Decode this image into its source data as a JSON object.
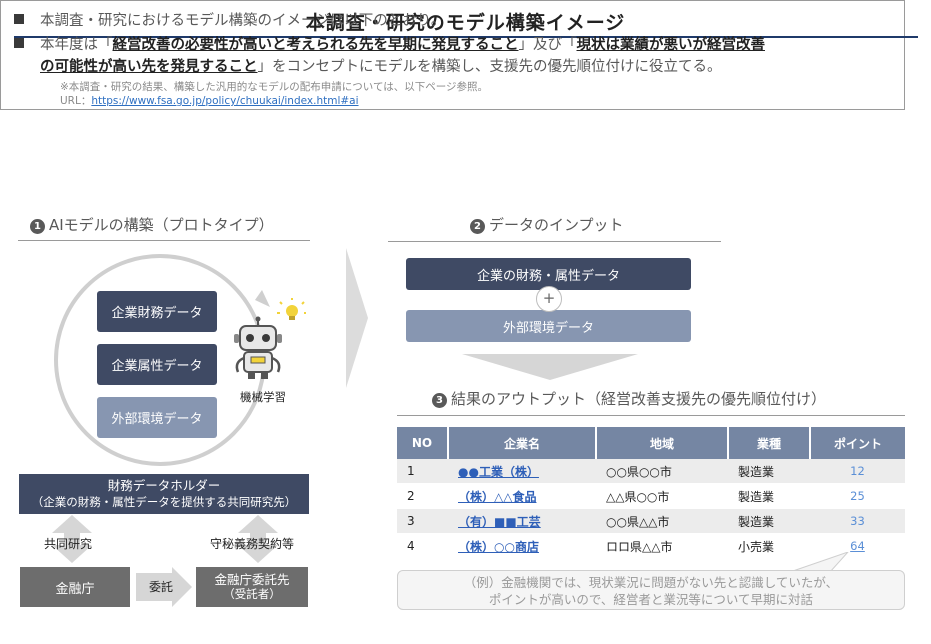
{
  "title": "本調査・研究のモデル構築イメージ",
  "summary": {
    "line1": "本調査・研究におけるモデル構築のイメージは以下のとおり。",
    "line2_pre": "本年度は「",
    "line2_hl1": "経営改善の必要性が高いと考えられる先を早期に発見すること",
    "line2_mid": "」及び「",
    "line2_hl2a": "現状は業績が悪いが経営改善",
    "line3_hl2b": "の可能性が高い先を発見すること",
    "line3_post": "」をコンセプトにモデルを構築し、支援先の優先順位付けに役立てる。",
    "note": "※本調査・研究の結果、構築した汎用的なモデルの配布申請については、以下ページ参照。",
    "url_label": "URL：",
    "url": "https://www.fsa.go.jp/policy/chuukai/index.html#ai"
  },
  "section1": {
    "number": "1",
    "title": "AIモデルの構築（プロトタイプ）",
    "boxes": [
      "企業財務データ",
      "企業属性データ",
      "外部環境データ"
    ],
    "robot_label": "機械学習",
    "holder_line1": "財務データホルダー",
    "holder_line2": "（企業の財務・属性データを提供する共同研究先）",
    "joint_research": "共同研究",
    "confidentiality": "守秘義務契約等",
    "fsa": "金融庁",
    "entrust": "委託",
    "contractor_line1": "金融庁委託先",
    "contractor_line2": "（受託者）"
  },
  "section2": {
    "number": "2",
    "title": "データのインプット",
    "box1": "企業の財務・属性データ",
    "plus": "+",
    "box2": "外部環境データ"
  },
  "section3": {
    "number": "3",
    "title": "結果のアウトプット（経営改善支援先の優先順位付け）",
    "headers": [
      "NO",
      "企業名",
      "地域",
      "業種",
      "ポイント"
    ],
    "rows": [
      {
        "no": "1",
        "company": "●●工業（株）",
        "region": "○○県○○市",
        "industry": "製造業",
        "point": "12"
      },
      {
        "no": "2",
        "company": "（株）△△食品",
        "region": "△△県○○市",
        "industry": "製造業",
        "point": "25"
      },
      {
        "no": "3",
        "company": "（有）■■工芸",
        "region": "○○県△△市",
        "industry": "製造業",
        "point": "33"
      },
      {
        "no": "4",
        "company": "（株）○○商店",
        "region": "ロロ県△△市",
        "industry": "小売業",
        "point": "64"
      }
    ],
    "callout_line1": "（例）金融機関では、現状業況に問題がない先と認識していたが、",
    "callout_line2": "ポイントが高いので、経営者と業況等について早期に対話"
  },
  "colors": {
    "dark_box": "#3f4a64",
    "light_box": "#8796b1",
    "table_header": "#7586a3",
    "title_rule": "#1f3a6a",
    "link": "#2e6fc1"
  }
}
